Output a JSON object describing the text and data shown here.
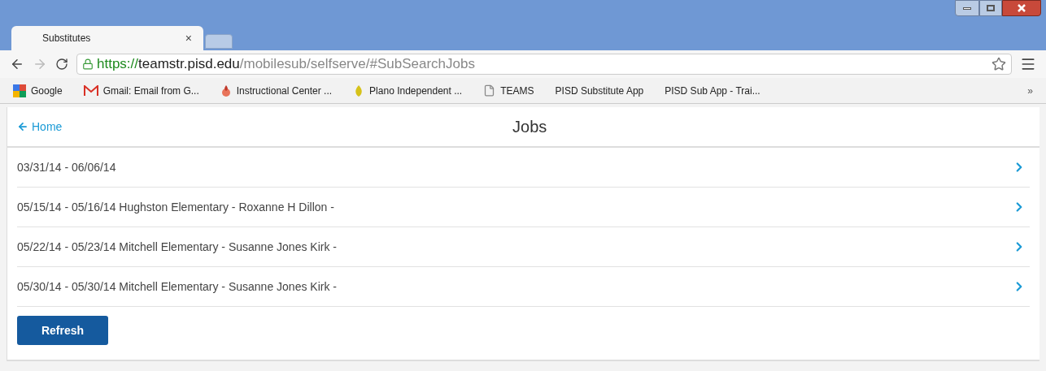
{
  "browser": {
    "tabs": [
      {
        "title": "Substitutes",
        "close": "×",
        "selected": true
      },
      {
        "selected": false
      }
    ],
    "url": {
      "scheme": "https://",
      "host": "teamstr.pisd.edu",
      "path": "/mobilesub/selfserve/#SubSearchJobs"
    },
    "bookmarks": [
      {
        "label": "Google",
        "kind": "google"
      },
      {
        "label": "Gmail: Email from G...",
        "kind": "gmail"
      },
      {
        "label": "Instructional Center ...",
        "kind": "flame"
      },
      {
        "label": "Plano Independent ...",
        "kind": "leaf"
      },
      {
        "label": "TEAMS",
        "kind": "page"
      },
      {
        "label": "PISD Substitute App",
        "kind": "none"
      },
      {
        "label": "PISD Sub App - Trai...",
        "kind": "none"
      }
    ],
    "more": "»"
  },
  "header": {
    "back": "Home",
    "title": "Jobs"
  },
  "jobs": [
    "03/31/14 - 06/06/14",
    "05/15/14 - 05/16/14 Hughston Elementary - Roxanne H Dillon -",
    "05/22/14 - 05/23/14 Mitchell Elementary - Susanne Jones Kirk -",
    "05/30/14 - 05/30/14 Mitchell Elementary - Susanne Jones Kirk -"
  ],
  "refresh": "Refresh"
}
